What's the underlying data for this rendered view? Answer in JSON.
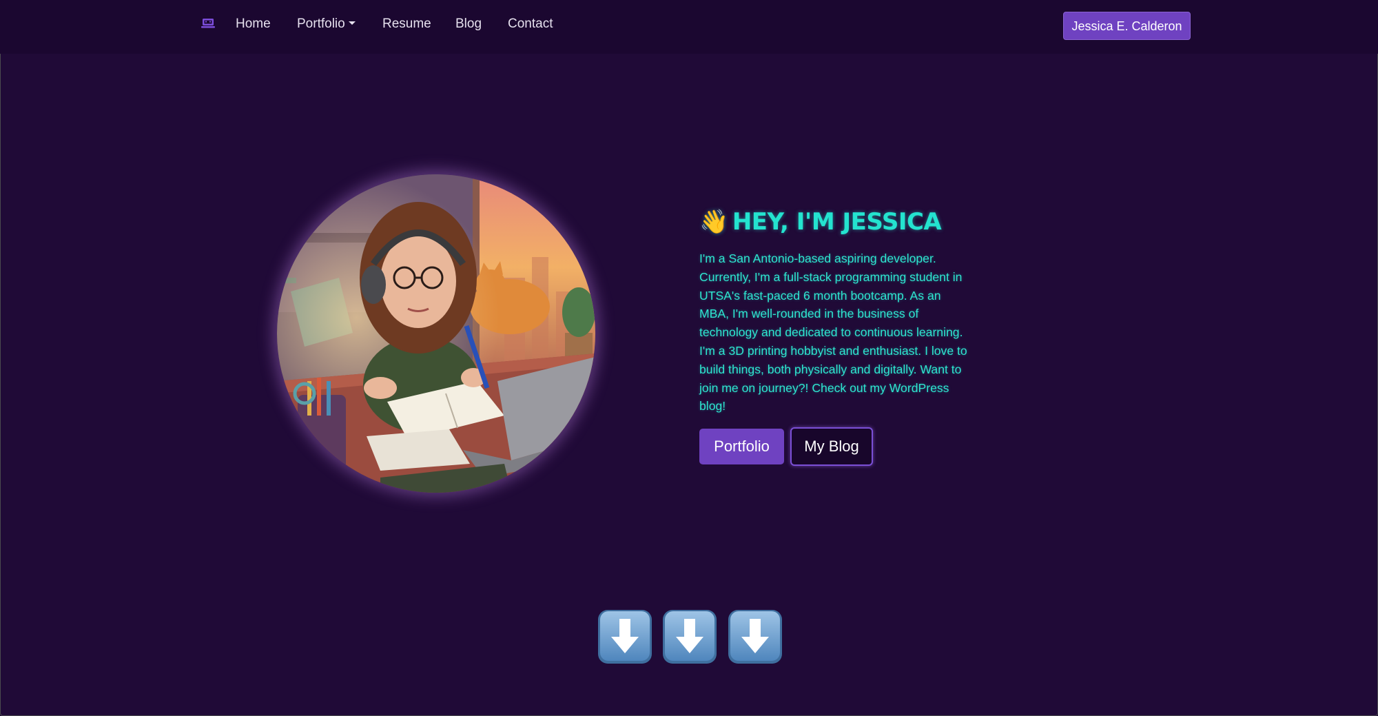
{
  "nav": {
    "brand_icon": "laptop-icon",
    "links": [
      "Home",
      "Portfolio",
      "Resume",
      "Blog",
      "Contact"
    ],
    "dropdown_caret_icon": "caret-down-icon",
    "user_button": "Jessica E. Calderon"
  },
  "hero": {
    "avatar_icon": "bitmoji-avatar-image",
    "wave_emoji": "👋",
    "title": "HEY, I'M JESSICA",
    "bio": "I'm a San Antonio-based aspiring developer. Currently, I'm a full-stack programming student in UTSA's fast-paced 6 month bootcamp. As an MBA, I'm well-rounded in the business of technology and dedicated to continuous learning. I'm a 3D printing hobbyist and enthusiast. I love to build things, both physically and digitally. Want to join me on journey?! Check out my WordPress blog!",
    "buttons": {
      "portfolio": "Portfolio",
      "blog": "My Blog"
    }
  },
  "scroll_arrows": {
    "icon": "down-arrow-icon",
    "count": 3
  },
  "colors": {
    "background": "#200a37",
    "navbar": "#1b0730",
    "accent_purple": "#6f42c1",
    "accent_teal": "#24e3cf"
  }
}
